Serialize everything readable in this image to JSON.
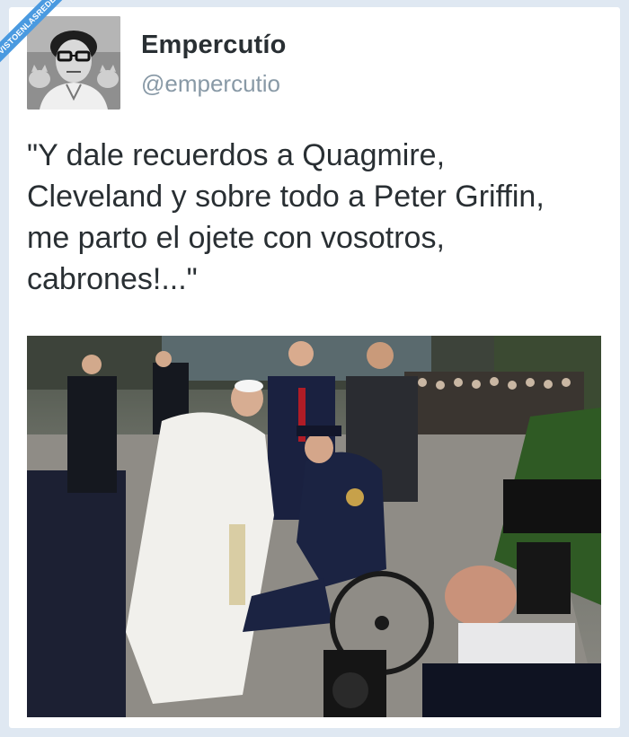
{
  "watermark": {
    "text": "VISTOENLASREDES.com"
  },
  "tweet": {
    "display_name": "Empercutío",
    "handle": "@empercutio",
    "text_lines": [
      "\"Y dale recuerdos a Quagmire,",
      "Cleveland y sobre todo a Peter Griffin,",
      "me parto el ojete con vosotros,",
      "cabrones!...\""
    ]
  },
  "colors": {
    "page_background": "#dfe8f2",
    "card_background": "#ffffff",
    "name_color": "#292f33",
    "handle_color": "#8899a6",
    "watermark_color": "#4a9ae0"
  }
}
